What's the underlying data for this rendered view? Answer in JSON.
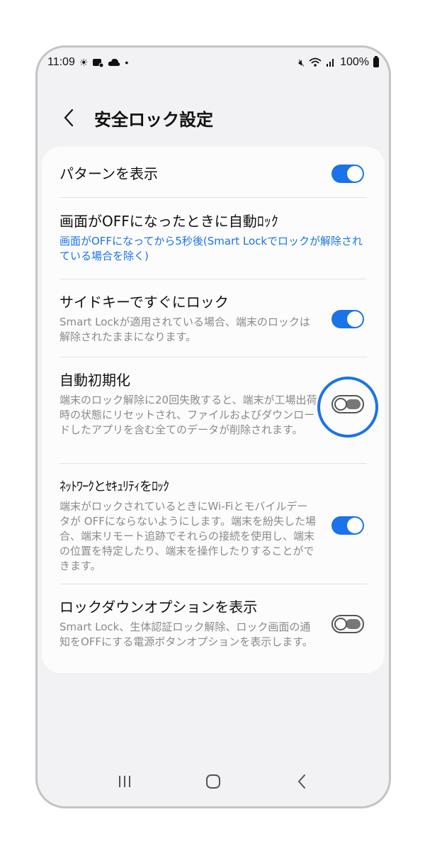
{
  "status_bar": {
    "time": "11:09",
    "battery": "100%"
  },
  "header": {
    "title": "安全ロック設定"
  },
  "settings": [
    {
      "title": "パターンを表示",
      "subtitle": "",
      "toggle": "on"
    },
    {
      "title": "画面がOFFになったときに自動ﾛｯｸ",
      "subtitle": "画面がOFFになってから5秒後(Smart Lockでロックが解除されている場合を除く)",
      "toggle": "none"
    },
    {
      "title": "サイドキーですぐにロック",
      "subtitle": "Smart Lockが適用されている場合、端末のロックは解除されたままになります。",
      "toggle": "on"
    },
    {
      "title": "自動初期化",
      "subtitle": "端末のロック解除に20回失敗すると、端末が工場出荷時の状態にリセットされ、ファイルおよびダウンロードしたアプリを含む全てのデータが削除されます。",
      "toggle": "off"
    },
    {
      "title": "ﾈｯﾄﾜｰｸとｾｷｭﾘﾃｨをﾛｯｸ",
      "subtitle": "端末がロックされているときにWi-Fiとモバイルデータが OFFにならないようにします。端末を紛失した場合、端末リモート追跡でそれらの接続を使用し、端末の位置を特定したり、端末を操作したりすることができます。",
      "toggle": "on"
    },
    {
      "title": "ロックダウンオプションを表示",
      "subtitle": "Smart Lock、生体認証ロック解除、ロック画面の通知をOFFにする電源ボタンオプションを表示します。",
      "toggle": "off"
    }
  ],
  "colors": {
    "accent": "#1a73e8",
    "background": "#f2f2f4",
    "card": "#fcfcfc"
  }
}
